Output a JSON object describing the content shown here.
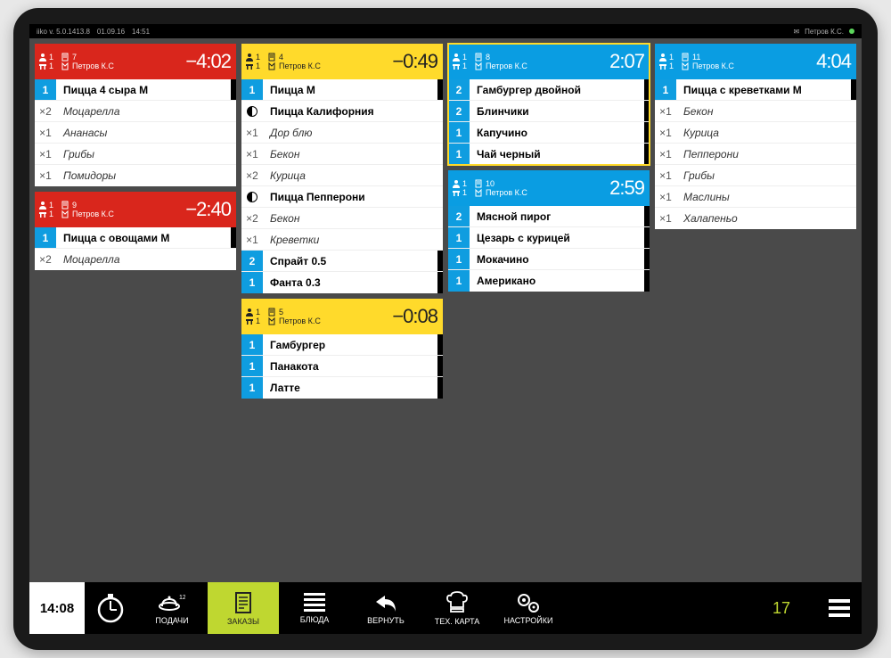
{
  "topbar": {
    "app": "iiko  v. 5.0.1413.8",
    "date": "01.09.16",
    "clock": "14:51",
    "user": "Петров К.С."
  },
  "staff_label": "Петров К.С",
  "columns": [
    [
      {
        "color": "h-red",
        "guests": "1",
        "table": "1",
        "order": "7",
        "time": "−4:02",
        "items": [
          {
            "q": "1",
            "cls": "qb",
            "name": "Пицца 4 сыра М",
            "b": true,
            "t": true
          },
          {
            "q": "×2",
            "cls": "qw",
            "name": "Моцарелла",
            "i": true
          },
          {
            "q": "×1",
            "cls": "qw",
            "name": "Ананасы",
            "i": true
          },
          {
            "q": "×1",
            "cls": "qw",
            "name": "Грибы",
            "i": true
          },
          {
            "q": "×1",
            "cls": "qw",
            "name": "Помидоры",
            "i": true
          }
        ]
      },
      {
        "color": "h-red",
        "guests": "1",
        "table": "1",
        "order": "9",
        "time": "−2:40",
        "items": [
          {
            "q": "1",
            "cls": "qb",
            "name": "Пицца с овощами М",
            "b": true,
            "t": true
          },
          {
            "q": "×2",
            "cls": "qw",
            "name": "Моцарелла",
            "i": true
          }
        ]
      }
    ],
    [
      {
        "color": "h-yellow",
        "guests": "1",
        "table": "1",
        "order": "4",
        "time": "−0:49",
        "items": [
          {
            "q": "1",
            "cls": "qb",
            "name": "Пицца М",
            "b": true,
            "t": true
          },
          {
            "q": "◐",
            "cls": "qw",
            "name": "Пицца Калифорния",
            "b": true,
            "half": true
          },
          {
            "q": "×1",
            "cls": "qw",
            "name": "Дор блю",
            "i": true
          },
          {
            "q": "×1",
            "cls": "qw",
            "name": "Бекон",
            "i": true
          },
          {
            "q": "×2",
            "cls": "qw",
            "name": "Курица",
            "i": true
          },
          {
            "q": "◐",
            "cls": "qw",
            "name": "Пицца Пепперони",
            "b": true,
            "half": true
          },
          {
            "q": "×2",
            "cls": "qw",
            "name": "Бекон",
            "i": true
          },
          {
            "q": "×1",
            "cls": "qw",
            "name": "Креветки",
            "i": true
          },
          {
            "q": "2",
            "cls": "qb",
            "name": "Спрайт 0.5",
            "b": true,
            "t": true
          },
          {
            "q": "1",
            "cls": "qb",
            "name": "Фанта 0.3",
            "b": true,
            "t": true
          }
        ]
      },
      {
        "color": "h-yellow",
        "guests": "1",
        "table": "1",
        "order": "5",
        "time": "−0:08",
        "items": [
          {
            "q": "1",
            "cls": "qb",
            "name": "Гамбургер",
            "b": true,
            "t": true
          },
          {
            "q": "1",
            "cls": "qb",
            "name": "Панакота",
            "b": true,
            "t": true
          },
          {
            "q": "1",
            "cls": "qb",
            "name": "Латте",
            "b": true,
            "t": true
          }
        ]
      }
    ],
    [
      {
        "color": "h-blue",
        "guests": "1",
        "table": "1",
        "order": "8",
        "time": "2:07",
        "border": true,
        "items": [
          {
            "q": "2",
            "cls": "qb",
            "name": "Гамбургер двойной",
            "b": true,
            "t": true
          },
          {
            "q": "2",
            "cls": "qb",
            "name": "Блинчики",
            "b": true,
            "t": true
          },
          {
            "q": "1",
            "cls": "qb",
            "name": "Капучино",
            "b": true,
            "t": true
          },
          {
            "q": "1",
            "cls": "qb",
            "name": "Чай черный",
            "b": true,
            "t": true
          }
        ]
      },
      {
        "color": "h-blue",
        "guests": "1",
        "table": "1",
        "order": "10",
        "time": "2:59",
        "items": [
          {
            "q": "2",
            "cls": "qb",
            "name": "Мясной пирог",
            "b": true,
            "t": true
          },
          {
            "q": "1",
            "cls": "qb",
            "name": " Цезарь с курицей",
            "b": true,
            "t": true
          },
          {
            "q": "1",
            "cls": "qb",
            "name": "Мокачино",
            "b": true,
            "t": true
          },
          {
            "q": "1",
            "cls": "qb",
            "name": "Американо",
            "b": true,
            "t": true
          }
        ]
      }
    ],
    [
      {
        "color": "h-blue",
        "guests": "1",
        "table": "1",
        "order": "11",
        "time": "4:04",
        "items": [
          {
            "q": "1",
            "cls": "qb",
            "name": "Пицца с креветками М",
            "b": true,
            "t": true
          },
          {
            "q": "×1",
            "cls": "qw",
            "name": "Бекон",
            "i": true
          },
          {
            "q": "×1",
            "cls": "qw",
            "name": "Курица",
            "i": true
          },
          {
            "q": "×1",
            "cls": "qw",
            "name": "Пепперони",
            "i": true
          },
          {
            "q": "×1",
            "cls": "qw",
            "name": "Грибы",
            "i": true
          },
          {
            "q": "×1",
            "cls": "qw",
            "name": "Маслины",
            "i": true
          },
          {
            "q": "×1",
            "cls": "qw",
            "name": "Халапеньо",
            "i": true
          }
        ]
      }
    ]
  ],
  "bottom": {
    "clock": "14:08",
    "count": "17",
    "buttons": [
      {
        "label": "ПОДАЧИ",
        "icon": "serve"
      },
      {
        "label": "ЗАКАЗЫ",
        "icon": "orders",
        "active": true
      },
      {
        "label": "БЛЮДА",
        "icon": "list"
      },
      {
        "label": "ВЕРНУТЬ",
        "icon": "undo"
      },
      {
        "label": "ТЕХ. КАРТА",
        "icon": "chef"
      },
      {
        "label": "НАСТРОЙКИ",
        "icon": "gears"
      }
    ]
  }
}
